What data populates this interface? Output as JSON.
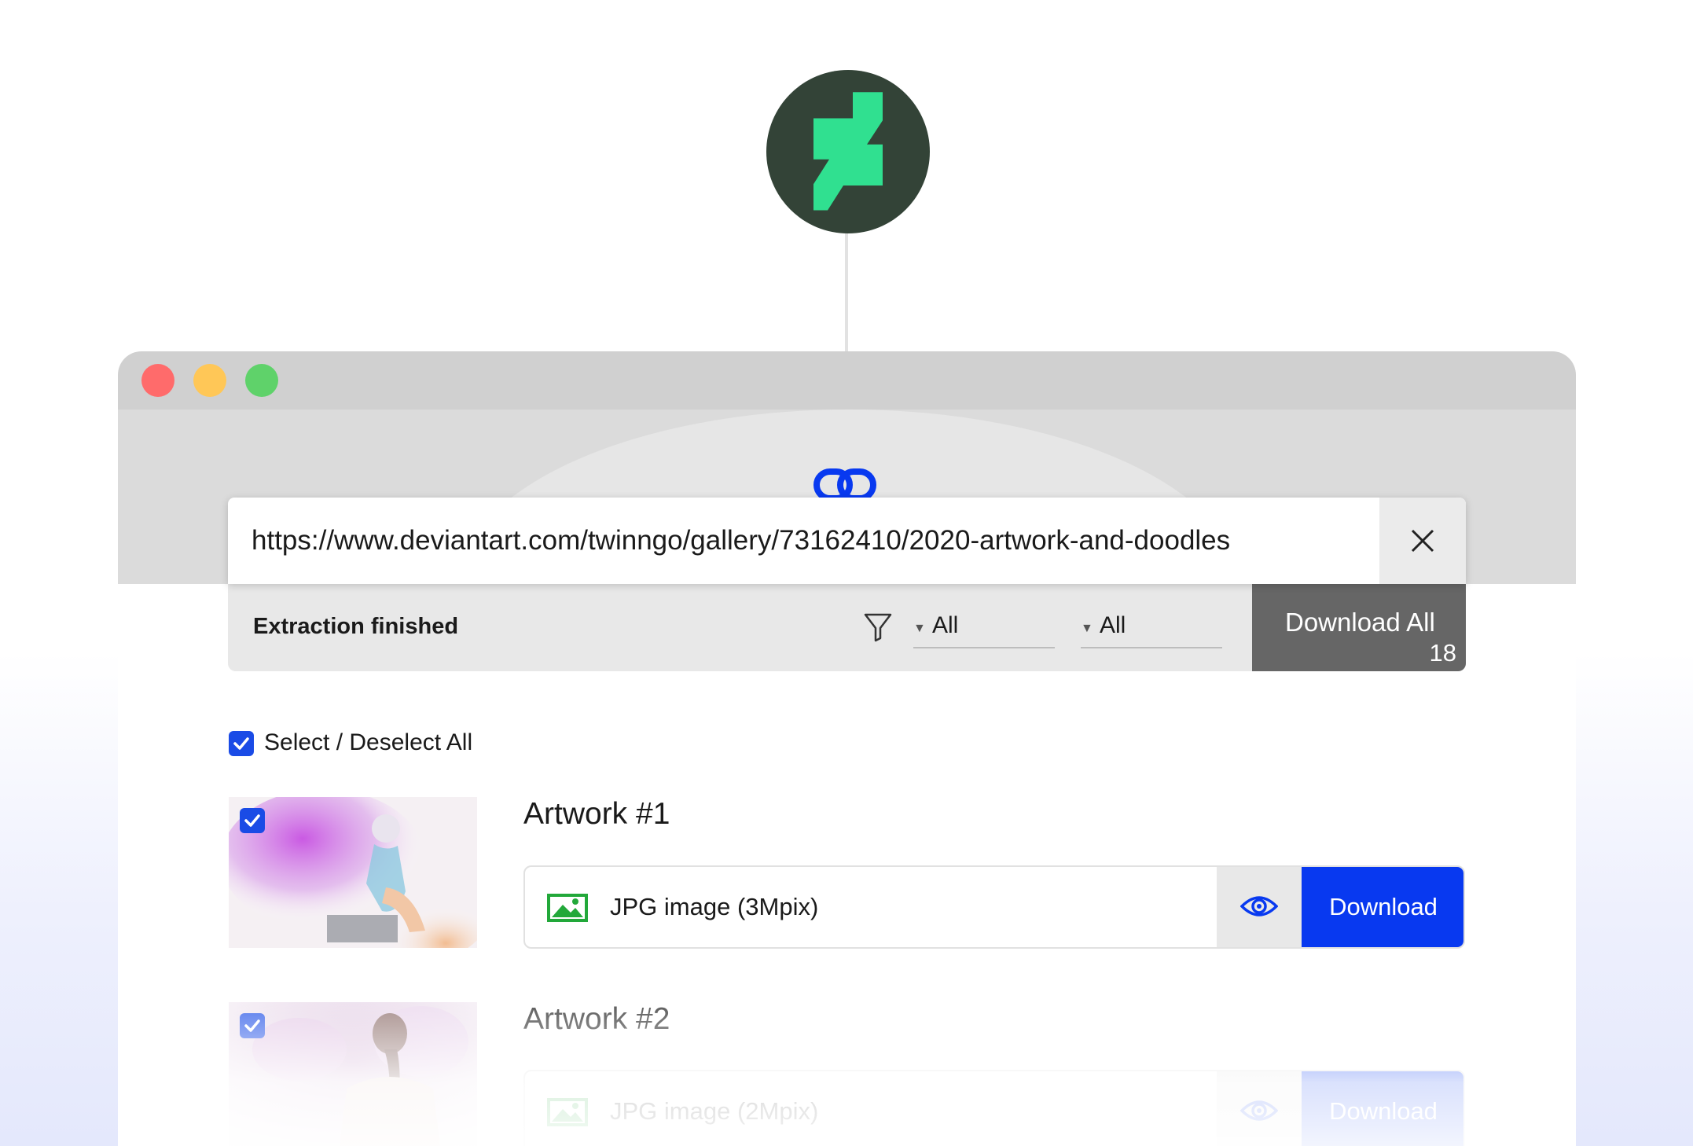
{
  "brand": {
    "logo_icon": "deviantart-logo-icon",
    "accent": "#30e090",
    "circle_color": "#334337"
  },
  "window": {
    "controls": [
      "close",
      "minimize",
      "maximize"
    ],
    "app_icon": "chain-link-icon",
    "accent": "#0839f0"
  },
  "url_bar": {
    "value": "https://www.deviantart.com/twinngo/gallery/73162410/2020-artwork-and-doodles",
    "clear_icon": "close-icon"
  },
  "status_bar": {
    "status": "Extraction finished",
    "filter_icon": "filter-icon",
    "filter_1": "All",
    "filter_2": "All",
    "download_all_label": "Download All",
    "download_all_count": "18"
  },
  "select_all": {
    "label": "Select / Deselect All",
    "checked": true
  },
  "items": [
    {
      "title": "Artwork #1",
      "file_label": "JPG image (3Mpix)",
      "download_label": "Download",
      "checked": true
    },
    {
      "title": "Artwork #2",
      "file_label": "JPG image (2Mpix)",
      "download_label": "Download",
      "checked": true
    }
  ]
}
